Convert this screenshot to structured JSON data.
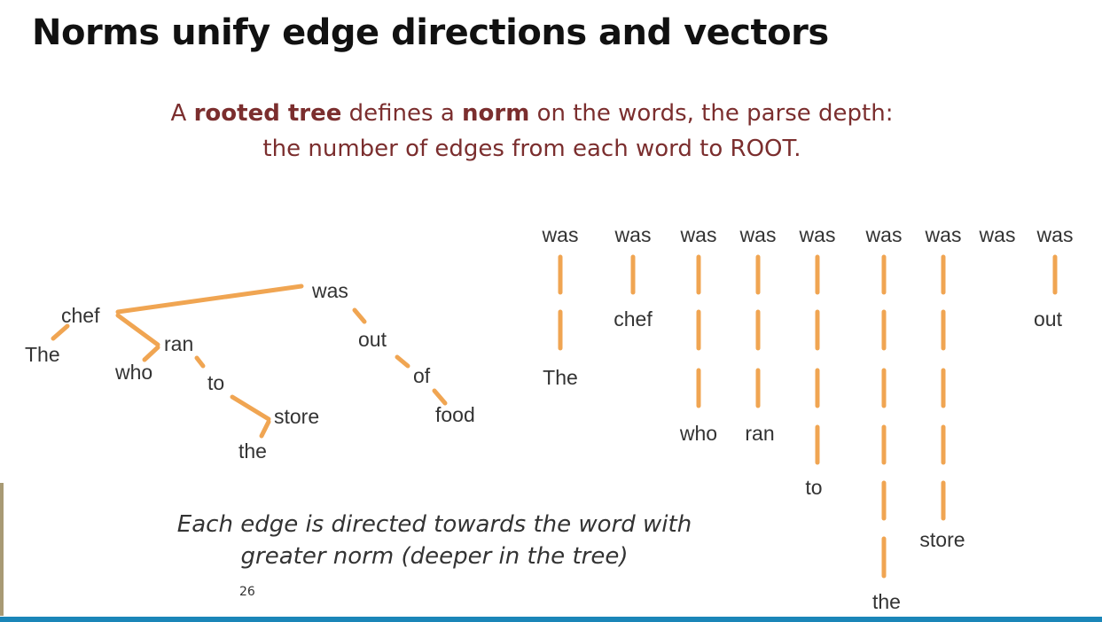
{
  "slide": {
    "title": "Norms unify edge directions and vectors",
    "subtitle_line1_pre": "A ",
    "subtitle_bold1": "rooted tree",
    "subtitle_line1_mid": " defines a ",
    "subtitle_bold2": "norm",
    "subtitle_line1_post": " on the words, the parse depth:",
    "subtitle_line2": "the number of edges from each word to ROOT.",
    "footnote_line1": "Each edge is directed towards the word with",
    "footnote_line2": "greater norm (deeper in the tree)",
    "page_number": "26"
  },
  "tree": {
    "words": {
      "was": "was",
      "chef": "chef",
      "the1": "The",
      "ran": "ran",
      "who": "who",
      "to": "to",
      "store": "store",
      "the2": "the",
      "out": "out",
      "of": "of",
      "food": "food"
    }
  },
  "columns": {
    "root_label": "was",
    "words": [
      "The",
      "chef",
      "who",
      "ran",
      "to",
      "the",
      "store",
      "out"
    ]
  },
  "colors": {
    "edge": "#f0a552",
    "subtitle": "#7b2e2e",
    "bottom_bar": "#1a86b8"
  }
}
